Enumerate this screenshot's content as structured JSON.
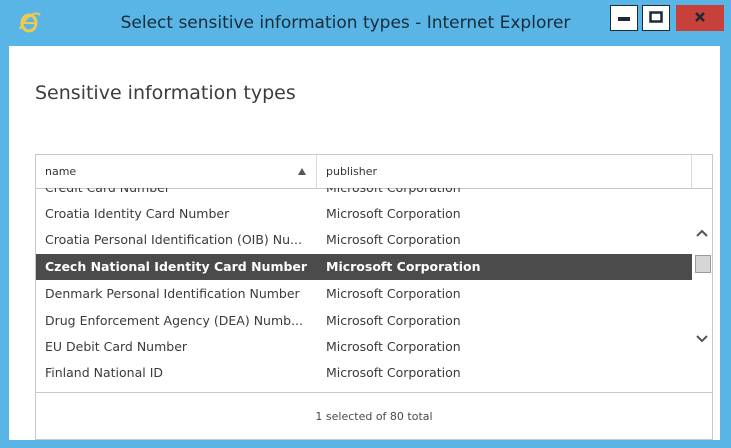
{
  "window": {
    "title": "Select sensitive information types - Internet Explorer",
    "app_icon": "internet-explorer-icon"
  },
  "page": {
    "title": "Sensitive information types"
  },
  "table": {
    "columns": [
      {
        "label": "name",
        "sort": "ascending"
      },
      {
        "label": "publisher"
      }
    ],
    "rows": [
      {
        "name": "Credit Card Number",
        "publisher": "Microsoft Corporation",
        "selected": false
      },
      {
        "name": "Croatia Identity Card Number",
        "publisher": "Microsoft Corporation",
        "selected": false
      },
      {
        "name": "Croatia Personal Identification (OIB) Nu...",
        "publisher": "Microsoft Corporation",
        "selected": false
      },
      {
        "name": "Czech National Identity Card Number",
        "publisher": "Microsoft Corporation",
        "selected": true
      },
      {
        "name": "Denmark Personal Identification Number",
        "publisher": "Microsoft Corporation",
        "selected": false
      },
      {
        "name": "Drug Enforcement Agency (DEA) Numb...",
        "publisher": "Microsoft Corporation",
        "selected": false
      },
      {
        "name": "EU Debit Card Number",
        "publisher": "Microsoft Corporation",
        "selected": false
      },
      {
        "name": "Finland National ID",
        "publisher": "Microsoft Corporation",
        "selected": false
      }
    ],
    "footer": "1 selected of 80 total"
  },
  "colors": {
    "titlebar": "#58b5e6",
    "close_button": "#c7403a",
    "selected_row": "#4b4b4b"
  }
}
